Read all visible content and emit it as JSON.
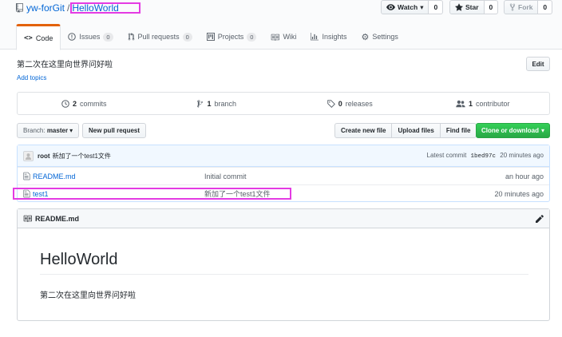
{
  "repo": {
    "owner": "yw-forGit",
    "separator": "/",
    "name": "HelloWorld"
  },
  "actions": {
    "watch": {
      "label": "Watch",
      "count": "0"
    },
    "star": {
      "label": "Star",
      "count": "0"
    },
    "fork": {
      "label": "Fork",
      "count": "0"
    }
  },
  "tabs": [
    {
      "label": "Code",
      "icon": "code-icon",
      "count": ""
    },
    {
      "label": "Issues",
      "icon": "issue-icon",
      "count": "0"
    },
    {
      "label": "Pull requests",
      "icon": "pull-request-icon",
      "count": "0"
    },
    {
      "label": "Projects",
      "icon": "project-icon",
      "count": "0"
    },
    {
      "label": "Wiki",
      "icon": "book-icon",
      "count": ""
    },
    {
      "label": "Insights",
      "icon": "graph-icon",
      "count": ""
    },
    {
      "label": "Settings",
      "icon": "gear-icon",
      "count": ""
    }
  ],
  "description": "第二次在这里向世界问好啦",
  "add_topics": "Add topics",
  "edit_label": "Edit",
  "summary": {
    "commits_count": "2",
    "commits_label": "commits",
    "branches_count": "1",
    "branches_label": "branch",
    "releases_count": "0",
    "releases_label": "releases",
    "contributors_count": "1",
    "contributors_label": "contributor"
  },
  "toolbar": {
    "branch_label": "Branch:",
    "branch_value": "master",
    "new_pr": "New pull request",
    "create_file": "Create new file",
    "upload_files": "Upload files",
    "find_file": "Find file",
    "clone": "Clone or download"
  },
  "latest_commit": {
    "author": "root",
    "message": "新加了一个test1文件",
    "label": "Latest commit",
    "sha": "1bed97c",
    "age": "20 minutes ago"
  },
  "files": [
    {
      "name": "README.md",
      "message": "Initial commit",
      "age": "an hour ago"
    },
    {
      "name": "test1",
      "message": "新加了一个test1文件",
      "age": "20 minutes ago"
    }
  ],
  "readme": {
    "filename": "README.md",
    "heading": "HelloWorld",
    "text": "第二次在这里向世界问好啦"
  },
  "colors": {
    "accent_tab": "#e36209",
    "link": "#0366d6",
    "clone_green": "#28a745",
    "annotation_box": "#e43be3"
  }
}
